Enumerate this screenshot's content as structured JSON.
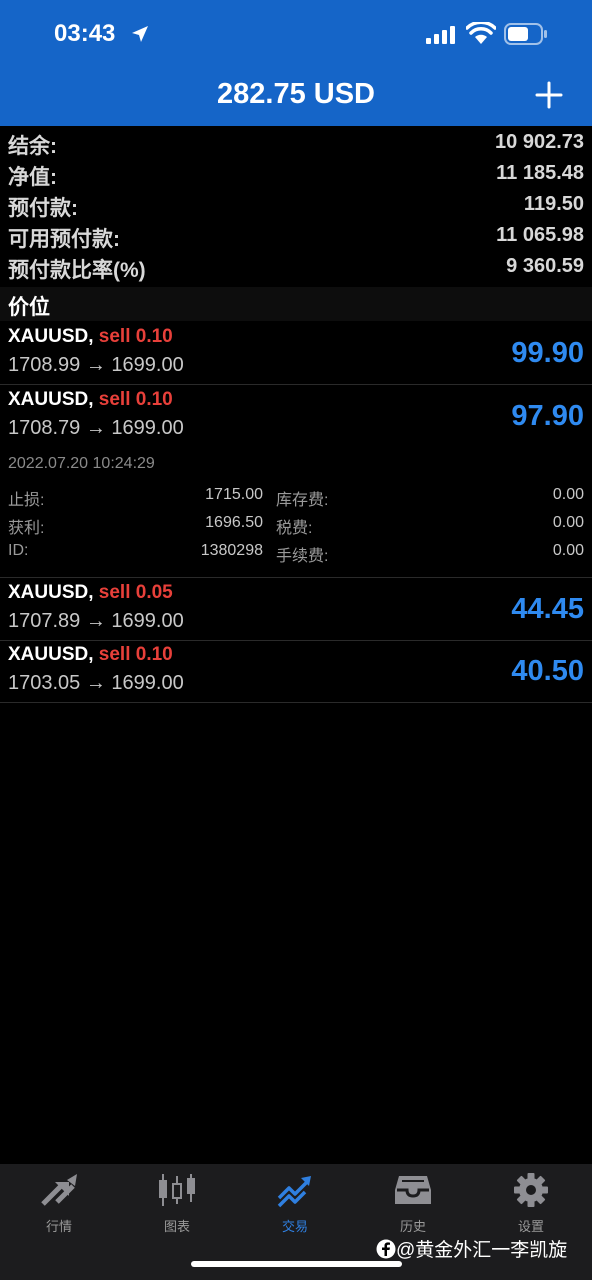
{
  "status_bar": {
    "time": "03:43"
  },
  "header": {
    "title": "282.75 USD"
  },
  "summary": [
    {
      "label": "结余:",
      "value": "10 902.73"
    },
    {
      "label": "净值:",
      "value": "11 185.48"
    },
    {
      "label": "预付款:",
      "value": "119.50"
    },
    {
      "label": "可用预付款:",
      "value": "11 065.98"
    },
    {
      "label": "预付款比率(%)",
      "value": "9 360.59"
    }
  ],
  "section_title": "价位",
  "positions": [
    {
      "symbol": "XAUUSD,",
      "side": "sell 0.10",
      "prices": "1708.99 → 1699.00",
      "profit": "99.90"
    },
    {
      "symbol": "XAUUSD,",
      "side": "sell 0.10",
      "prices": "1708.79 → 1699.00",
      "profit": "97.90"
    },
    {
      "symbol": "XAUUSD,",
      "side": "sell 0.05",
      "prices": "1707.89 → 1699.00",
      "profit": "44.45"
    },
    {
      "symbol": "XAUUSD,",
      "side": "sell 0.10",
      "prices": "1703.05 → 1699.00",
      "profit": "40.50"
    }
  ],
  "details": {
    "datetime": "2022.07.20 10:24:29",
    "rows": [
      {
        "l1": "止损:",
        "v1": "1715.00",
        "l2": "库存费:",
        "v2": "0.00"
      },
      {
        "l1": "获利:",
        "v1": "1696.50",
        "l2": "税费:",
        "v2": "0.00"
      },
      {
        "l1": "ID:",
        "v1": "1380298",
        "l2": "手续费:",
        "v2": "0.00"
      }
    ]
  },
  "tabs": [
    {
      "label": "行情",
      "icon": "quotes-arrows-icon"
    },
    {
      "label": "图表",
      "icon": "candlestick-chart-icon"
    },
    {
      "label": "交易",
      "icon": "trade-trend-icon",
      "active": true
    },
    {
      "label": "历史",
      "icon": "history-inbox-icon"
    },
    {
      "label": "设置",
      "icon": "gear-icon"
    }
  ],
  "watermark": "@黄金外汇一李凯旋",
  "colors": {
    "header": "#1565c8",
    "profit": "#2f8af0",
    "sell": "#e8403a",
    "active_tab": "#2f7fe0"
  }
}
